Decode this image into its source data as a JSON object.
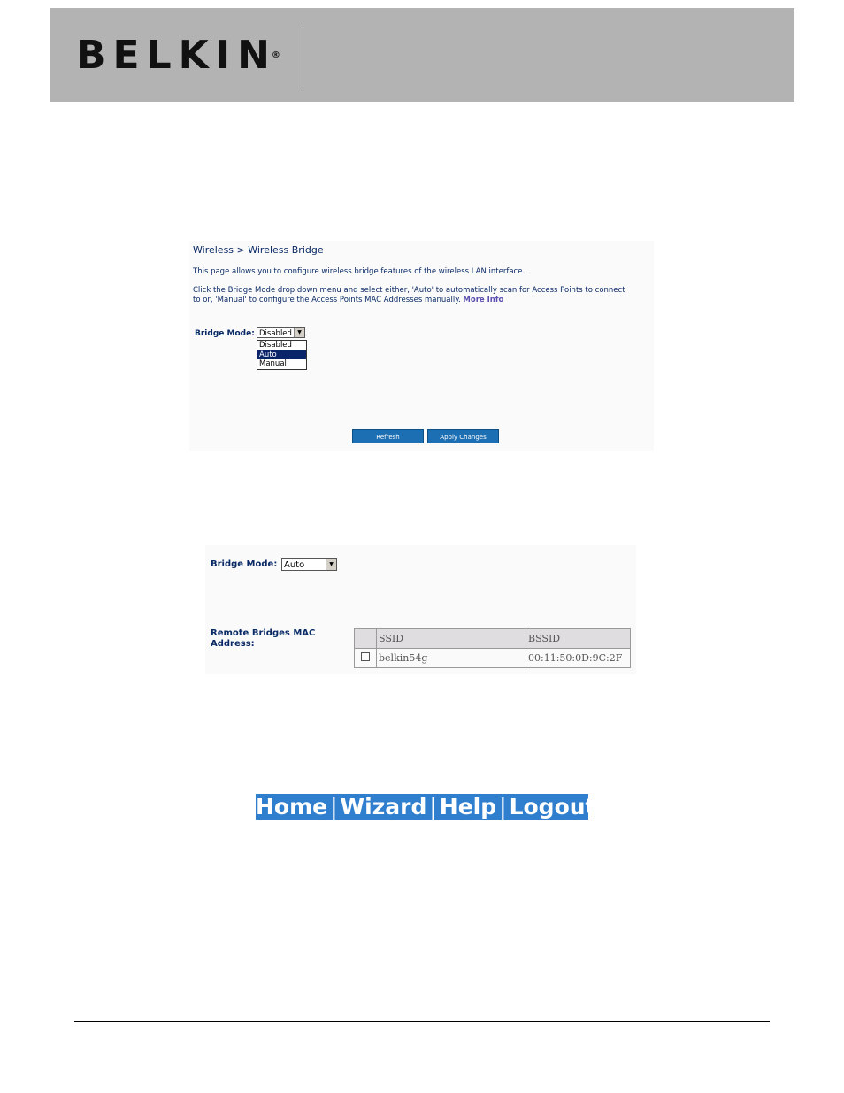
{
  "brand": {
    "logo_text": "BELKIN",
    "registered": "®"
  },
  "page": {
    "breadcrumb": "Wireless > Wireless Bridge",
    "intro": "This page allows you to configure wireless bridge features of the wireless LAN interface.",
    "instructions_1": "Click the Bridge Mode drop down menu and select either, 'Auto' to automatically scan for Access Points to connect",
    "instructions_2": "to or, 'Manual' to configure the Access Points MAC Addresses manually.",
    "more_info": "More Info",
    "bridge_mode_label": "Bridge Mode:",
    "bridge_mode_value": "Disabled",
    "bridge_mode_options": [
      "Disabled",
      "Auto",
      "Manual"
    ],
    "refresh_label": "Refresh",
    "apply_label": "Apply Changes"
  },
  "panel2": {
    "bridge_mode_label": "Bridge Mode:",
    "bridge_mode_value": "Auto",
    "remote_label_1": "Remote Bridges MAC",
    "remote_label_2": "Address:",
    "table": {
      "headers": [
        "SSID",
        "BSSID"
      ],
      "rows": [
        {
          "ssid": "belkin54g",
          "bssid": "00:11:50:0D:9C:2F"
        }
      ]
    }
  },
  "nav": {
    "home": "Home",
    "wizard": "Wizard",
    "help": "Help",
    "logout": "Logout",
    "sep": "|"
  },
  "colors": {
    "header_gray": "#b3b3b3",
    "nav_blue": "#2f7fce",
    "button_blue": "#1c6fb3",
    "text_navy": "#0a2a66"
  }
}
